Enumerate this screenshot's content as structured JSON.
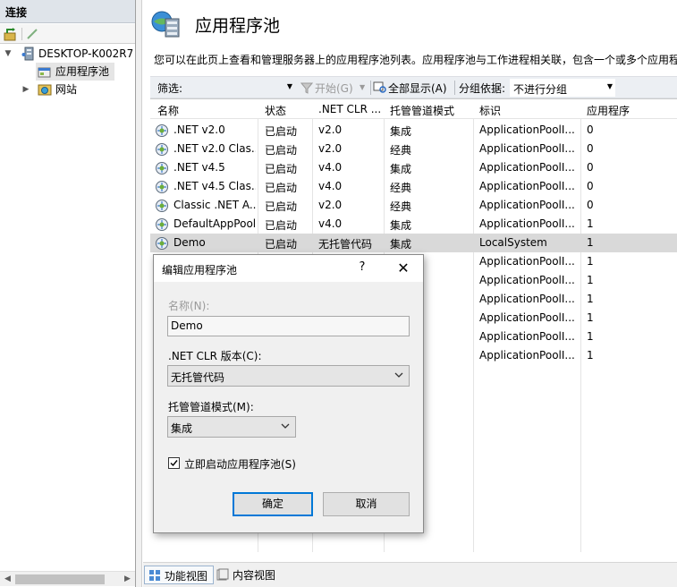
{
  "connections": {
    "header": "连接",
    "tree": [
      {
        "label": "DESKTOP-K002R7",
        "icon": "server-icon",
        "expanded": true
      },
      {
        "label": "应用程序池",
        "icon": "app-pool-icon",
        "selected": true
      },
      {
        "label": "网站",
        "icon": "sites-icon",
        "expanded": false
      }
    ]
  },
  "page": {
    "title": "应用程序池",
    "description": "您可以在此页上查看和管理服务器上的应用程序池列表。应用程序池与工作进程相关联，包含一个或多个应用程"
  },
  "filter_bar": {
    "filter_label": "筛选:",
    "go_label": "开始(G)",
    "show_all_label": "全部显示(A)",
    "group_by_label": "分组依据:",
    "group_by_value": "不进行分组"
  },
  "grid": {
    "columns": [
      "名称",
      "状态",
      ".NET CLR ...",
      "托管管道模式",
      "标识",
      "应用程序"
    ],
    "rows": [
      {
        "name": ".NET v2.0",
        "status": "已启动",
        "clr": "v2.0",
        "pipeline": "集成",
        "identity": "ApplicationPoolI...",
        "apps": "0"
      },
      {
        "name": ".NET v2.0 Clas...",
        "status": "已启动",
        "clr": "v2.0",
        "pipeline": "经典",
        "identity": "ApplicationPoolI...",
        "apps": "0"
      },
      {
        "name": ".NET v4.5",
        "status": "已启动",
        "clr": "v4.0",
        "pipeline": "集成",
        "identity": "ApplicationPoolI...",
        "apps": "0"
      },
      {
        "name": ".NET v4.5 Clas...",
        "status": "已启动",
        "clr": "v4.0",
        "pipeline": "经典",
        "identity": "ApplicationPoolI...",
        "apps": "0"
      },
      {
        "name": "Classic .NET A...",
        "status": "已启动",
        "clr": "v2.0",
        "pipeline": "经典",
        "identity": "ApplicationPoolI...",
        "apps": "0"
      },
      {
        "name": "DefaultAppPool",
        "status": "已启动",
        "clr": "v4.0",
        "pipeline": "集成",
        "identity": "ApplicationPoolI...",
        "apps": "1"
      },
      {
        "name": "Demo",
        "status": "已启动",
        "clr": "无托管代码",
        "pipeline": "集成",
        "identity": "LocalSystem",
        "apps": "1",
        "selected": true
      },
      {
        "identity": "ApplicationPoolI...",
        "apps": "1"
      },
      {
        "identity": "ApplicationPoolI...",
        "apps": "1"
      },
      {
        "identity": "ApplicationPoolI...",
        "apps": "1"
      },
      {
        "identity": "ApplicationPoolI...",
        "apps": "1"
      },
      {
        "identity": "ApplicationPoolI...",
        "apps": "1"
      },
      {
        "identity": "ApplicationPoolI...",
        "apps": "1"
      }
    ]
  },
  "views": {
    "features_view": "功能视图",
    "content_view": "内容视图"
  },
  "dialog": {
    "title": "编辑应用程序池",
    "help": "?",
    "close": "✕",
    "name_label": "名称(N):",
    "name_value": "Demo",
    "clr_label": ".NET CLR 版本(C):",
    "clr_value": "无托管代码",
    "pipeline_label": "托管管道模式(M):",
    "pipeline_value": "集成",
    "autostart_label": "立即启动应用程序池(S)",
    "autostart_checked": true,
    "ok": "确定",
    "cancel": "取消"
  },
  "colors": {
    "selection": "#d9d9d9",
    "accent": "#0078d7",
    "header_bg": "#dfe4ea"
  }
}
